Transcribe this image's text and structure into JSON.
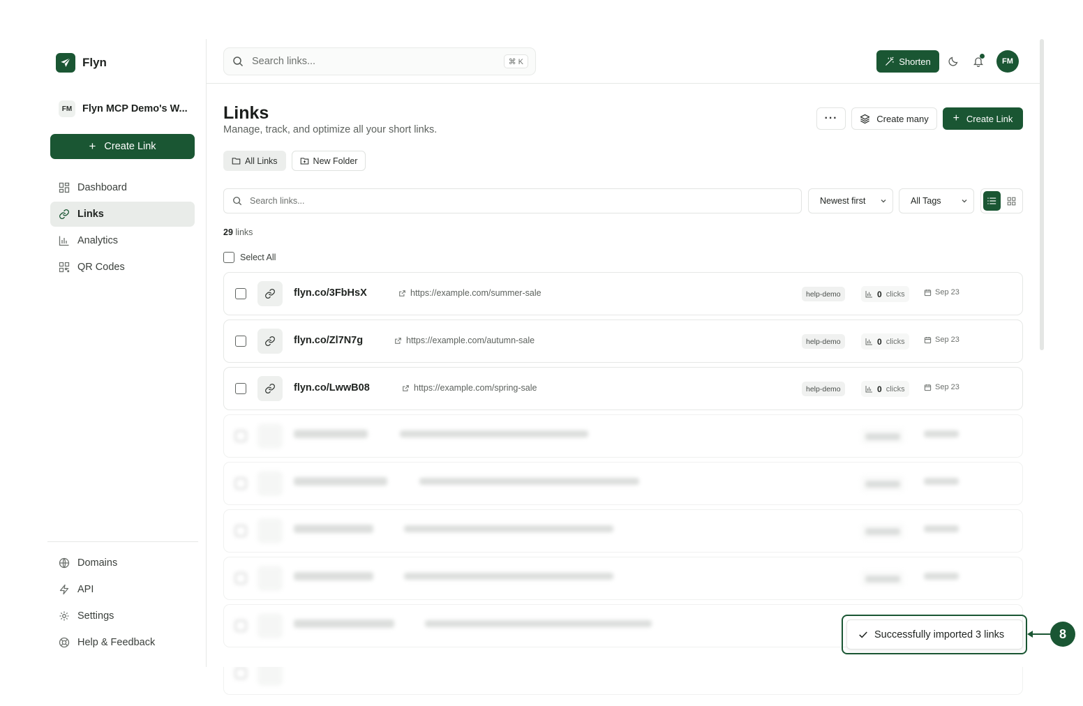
{
  "brand": {
    "name": "Flyn"
  },
  "workspace": {
    "initials": "FM",
    "name": "Flyn MCP Demo's W..."
  },
  "sidebar": {
    "create_label": "Create Link",
    "items": [
      {
        "label": "Dashboard",
        "icon": "dashboard-icon",
        "active": false
      },
      {
        "label": "Links",
        "icon": "link-icon",
        "active": true
      },
      {
        "label": "Analytics",
        "icon": "bar-chart-icon",
        "active": false
      },
      {
        "label": "QR Codes",
        "icon": "qr-code-icon",
        "active": false
      }
    ],
    "bottom_items": [
      {
        "label": "Domains",
        "icon": "globe-icon"
      },
      {
        "label": "API",
        "icon": "bolt-icon"
      },
      {
        "label": "Settings",
        "icon": "gear-icon"
      },
      {
        "label": "Help & Feedback",
        "icon": "lifebuoy-icon"
      }
    ]
  },
  "topbar": {
    "search_placeholder": "Search links...",
    "shortcut": "⌘ K",
    "shorten_label": "Shorten",
    "user_initials": "FM"
  },
  "page": {
    "title": "Links",
    "subtitle": "Manage, track, and optimize all your short links.",
    "more_label": "···",
    "create_many_label": "Create many",
    "create_link_label": "Create Link",
    "folders": [
      {
        "label": "All Links",
        "icon": "folder-icon",
        "active": true
      },
      {
        "label": "New Folder",
        "icon": "folder-plus-icon",
        "active": false
      }
    ],
    "search_placeholder": "Search links...",
    "sort_value": "Newest first",
    "tags_value": "All Tags",
    "link_count": "29",
    "link_count_suffix": "links",
    "select_all_label": "Select All"
  },
  "links": [
    {
      "short": "flyn.co/3FbHsX",
      "destination": "https://example.com/summer-sale",
      "tag": "help-demo",
      "clicks": "0",
      "clicks_label": "clicks",
      "date": "Sep 23"
    },
    {
      "short": "flyn.co/Zl7N7g",
      "destination": "https://example.com/autumn-sale",
      "tag": "help-demo",
      "clicks": "0",
      "clicks_label": "clicks",
      "date": "Sep 23"
    },
    {
      "short": "flyn.co/LwwB08",
      "destination": "https://example.com/spring-sale",
      "tag": "help-demo",
      "clicks": "0",
      "clicks_label": "clicks",
      "date": "Sep 23"
    }
  ],
  "toast": {
    "message": "Successfully imported 3 links"
  },
  "callout": {
    "number": "8"
  },
  "colors": {
    "brand": "#1a5633",
    "border": "#e6e8e6",
    "muted_text": "#5d625e"
  }
}
